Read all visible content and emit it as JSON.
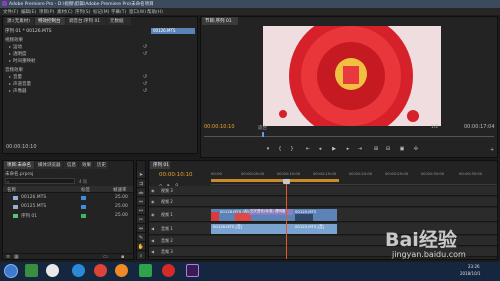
{
  "title_bar": {
    "text": "Adobe Premiere Pro - D:\\视频\\剪辑\\Adobe Premiere Pro\\未命名项目"
  },
  "menu": [
    "文件(F)",
    "编辑(E)",
    "项目(P)",
    "素材(C)",
    "序列(S)",
    "标记(M)",
    "字幕(T)",
    "窗口(W)",
    "帮助(H)"
  ],
  "source_panel": {
    "tabs": [
      "源:(无素材)",
      "特效控制台",
      "调音台:序列 01",
      "元数据"
    ],
    "header": "序列 01 * 00126.MTS",
    "clip_tag": "00126.MTS",
    "section_video": "视频效果",
    "effects_video": [
      "运动",
      "透明度",
      "时间重映射"
    ],
    "section_audio": "音频效果",
    "effects_audio": [
      "音量",
      "声道音量",
      "声像器"
    ],
    "timecode": "00:00:10:10"
  },
  "program_monitor": {
    "tab": "节目:序列 01",
    "timecode_left": "00:00:10:10",
    "fit": "适合",
    "scale": "1/2",
    "timecode_right": "00:00:17:04"
  },
  "project_panel": {
    "tabs": [
      "项目:未命名",
      "媒体浏览器",
      "信息",
      "效果",
      "历史"
    ],
    "project_name": "未命名.prproj",
    "item_count": "4 项",
    "col_name": "名称",
    "col_label": "标签",
    "col_fps": "帧速率",
    "items": [
      {
        "name": "00126.MTS",
        "fps": "25.00",
        "color": "#3f8de0"
      },
      {
        "name": "00125.MTS",
        "fps": "25.00",
        "color": "#3f8de0"
      },
      {
        "name": "序列 01",
        "fps": "25.00",
        "color": "#3fb463"
      }
    ]
  },
  "timeline": {
    "tab": "序列 01",
    "timecode": "00:00:10:10",
    "ruler": [
      "00:00",
      "00:00:05:00",
      "00:00:10:00",
      "00:00:15:00",
      "00:00:20:00",
      "00:00:25:00",
      "00:00:30:00",
      "00:00:35:00"
    ],
    "tracks": [
      "视频 3",
      "视频 2",
      "视频 1",
      "音频 1",
      "音频 2",
      "音频 3"
    ],
    "clip_v1_a": "00126.MTS [视]",
    "clip_v1_b": "交叉叠化(标准) 透明度",
    "clip_v1_c": "00125.MTS",
    "clip_a1_a": "00126.MTS [音]",
    "clip_a1_b": "00125.MTS [音]"
  },
  "taskbar": {
    "clock_time": "23:26",
    "clock_date": "2018/10/1"
  },
  "watermark": {
    "brand": "Bai经验",
    "url": "jingyan.baidu.com"
  },
  "colors": {
    "accent": "#f2a12c",
    "video_clip": "#5b83b8",
    "audio_clip": "#7aa3cf",
    "playhead": "#e05a2b",
    "taskbar": "#15263f"
  }
}
